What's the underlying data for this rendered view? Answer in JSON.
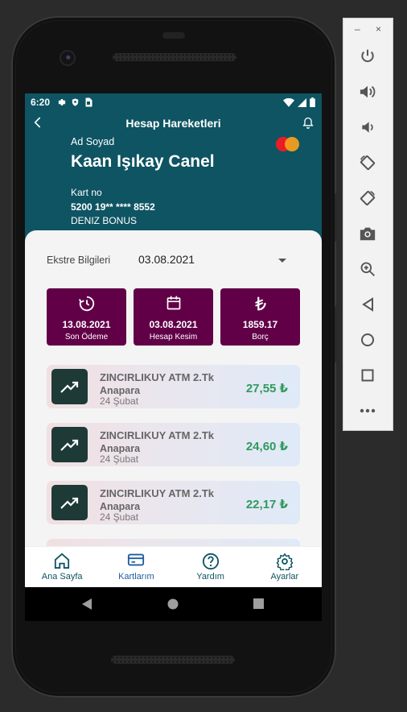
{
  "status_bar": {
    "time": "6:20"
  },
  "app_bar": {
    "title": "Hesap Hareketleri"
  },
  "account": {
    "holder_label": "Ad Soyad",
    "holder_name": "Kaan Işıkay Canel",
    "card_label": "Kart no",
    "card_number": "5200 19** **** 8552",
    "card_type": "DENIZ BONUS"
  },
  "statement": {
    "label": "Ekstre Bilgileri",
    "selected_date": "03.08.2021"
  },
  "summary": [
    {
      "value": "13.08.2021",
      "label": "Son Ödeme",
      "icon": "clock-icon"
    },
    {
      "value": "03.08.2021",
      "label": "Hesap Kesim",
      "icon": "calendar-icon"
    },
    {
      "value": "1859.17",
      "label": "Borç",
      "icon": "lira-icon"
    }
  ],
  "transactions": [
    {
      "name": "ZINCIRLIKUY ATM 2.Tk",
      "type": "Anapara",
      "date": "24 Şubat",
      "amount": "27,55 ₺"
    },
    {
      "name": "ZINCIRLIKUY ATM 2.Tk",
      "type": "Anapara",
      "date": "24 Şubat",
      "amount": "24,60 ₺"
    },
    {
      "name": "ZINCIRLIKUY ATM 2.Tk",
      "type": "Anapara",
      "date": "24 Şubat",
      "amount": "22,17 ₺"
    }
  ],
  "bottom_nav": [
    {
      "label": "Ana Sayfa",
      "icon": "home-icon"
    },
    {
      "label": "Kartlarım",
      "icon": "card-icon"
    },
    {
      "label": "Yardım",
      "icon": "help-icon"
    },
    {
      "label": "Ayarlar",
      "icon": "settings-icon"
    }
  ],
  "emulator_toolbar": {
    "window_minimize": "–",
    "window_close": "×",
    "tools": [
      "power-icon",
      "volume-up-icon",
      "volume-down-icon",
      "rotate-left-icon",
      "rotate-right-icon",
      "camera-icon",
      "zoom-icon",
      "back-icon",
      "home-icon",
      "overview-icon",
      "more-icon"
    ]
  },
  "colors": {
    "header": "#0e5463",
    "summary_box": "#610047",
    "amount": "#2f9a5c",
    "tx_icon_bg": "#1d3a37"
  }
}
